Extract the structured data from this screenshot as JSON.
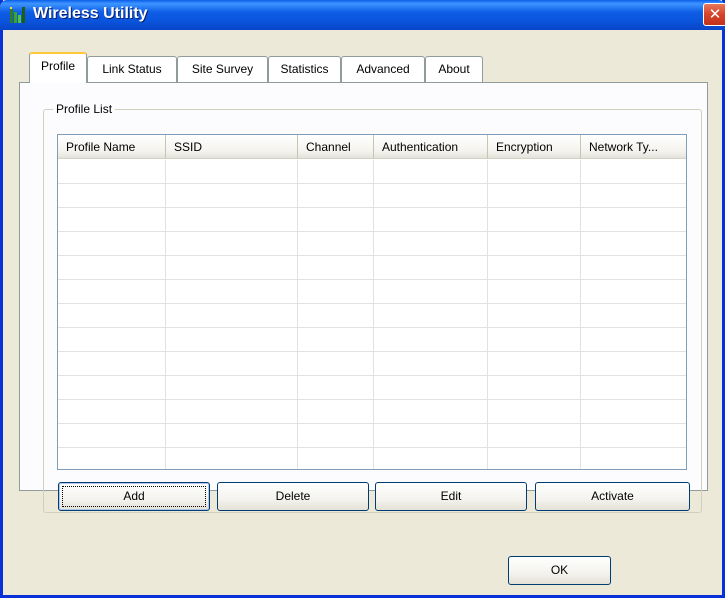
{
  "window": {
    "title": "Wireless Utility",
    "close_glyph": "✕",
    "icon": "signal-bars-icon"
  },
  "tabs": [
    {
      "label": "Profile",
      "active": true
    },
    {
      "label": "Link Status",
      "active": false
    },
    {
      "label": "Site Survey",
      "active": false
    },
    {
      "label": "Statistics",
      "active": false
    },
    {
      "label": "Advanced",
      "active": false
    },
    {
      "label": "About",
      "active": false
    }
  ],
  "profile_list": {
    "group_label": "Profile List",
    "columns": [
      "Profile Name",
      "SSID",
      "Channel",
      "Authentication",
      "Encryption",
      "Network Ty..."
    ],
    "rows": []
  },
  "buttons": {
    "add": "Add",
    "delete": "Delete",
    "edit": "Edit",
    "activate": "Activate",
    "ok": "OK"
  },
  "colors": {
    "title_bar": "#0a55dc",
    "window_bg": "#ece9d8",
    "tab_highlight": "#ffc83c",
    "close_button": "#d5432a"
  }
}
